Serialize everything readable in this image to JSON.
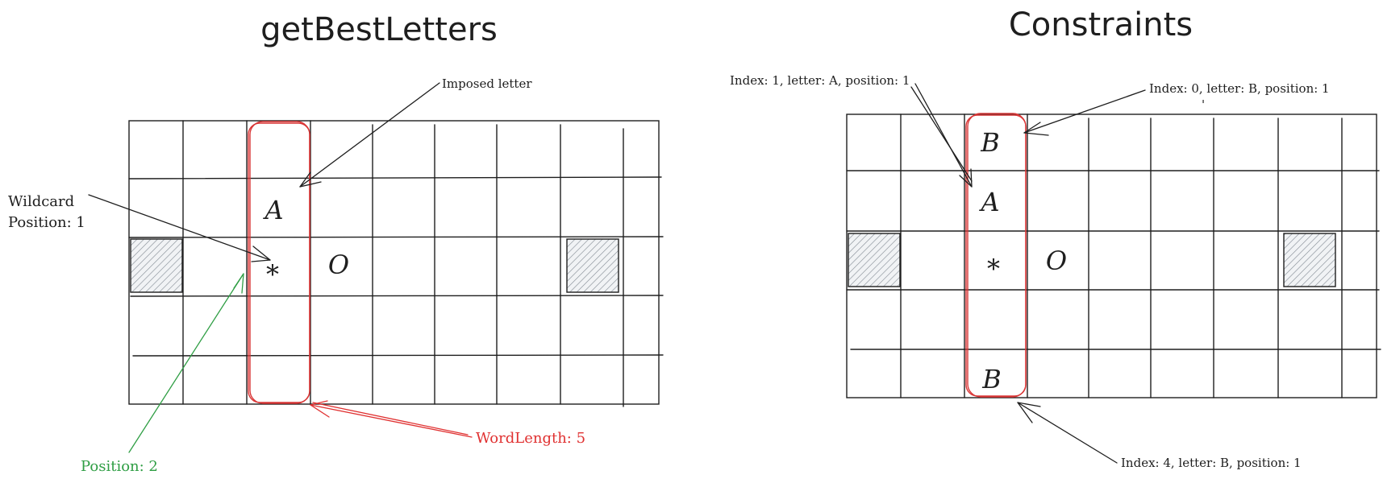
{
  "left_panel": {
    "title": "getBestLetters",
    "cells": {
      "a": "A",
      "star": "*",
      "o": "O"
    },
    "imposed_label": "Imposed letter",
    "wildcard_line1": "Wildcard",
    "wildcard_line2": "Position: 1",
    "position_label": "Position: 2",
    "wordlength_label": "WordLength: 5"
  },
  "right_panel": {
    "title": "Constraints",
    "cells": {
      "b_top": "B",
      "a": "A",
      "star": "*",
      "o": "O",
      "b_bottom": "B"
    },
    "constraint_a": "Index: 1, letter: A, position: 1",
    "constraint_b_top": "Index: 0, letter: B, position: 1",
    "constraint_b_bottom": "Index: 4, letter: B, position: 1",
    "tick_mark": "'"
  },
  "colors": {
    "ink": "#1e1e1e",
    "highlight_red": "#d93636",
    "annotation_red": "#e03131",
    "annotation_green": "#2f9e44",
    "hatch_fill": "#e9ecef"
  },
  "icons": [
    "hatched-block-icon",
    "arrow-icon"
  ]
}
